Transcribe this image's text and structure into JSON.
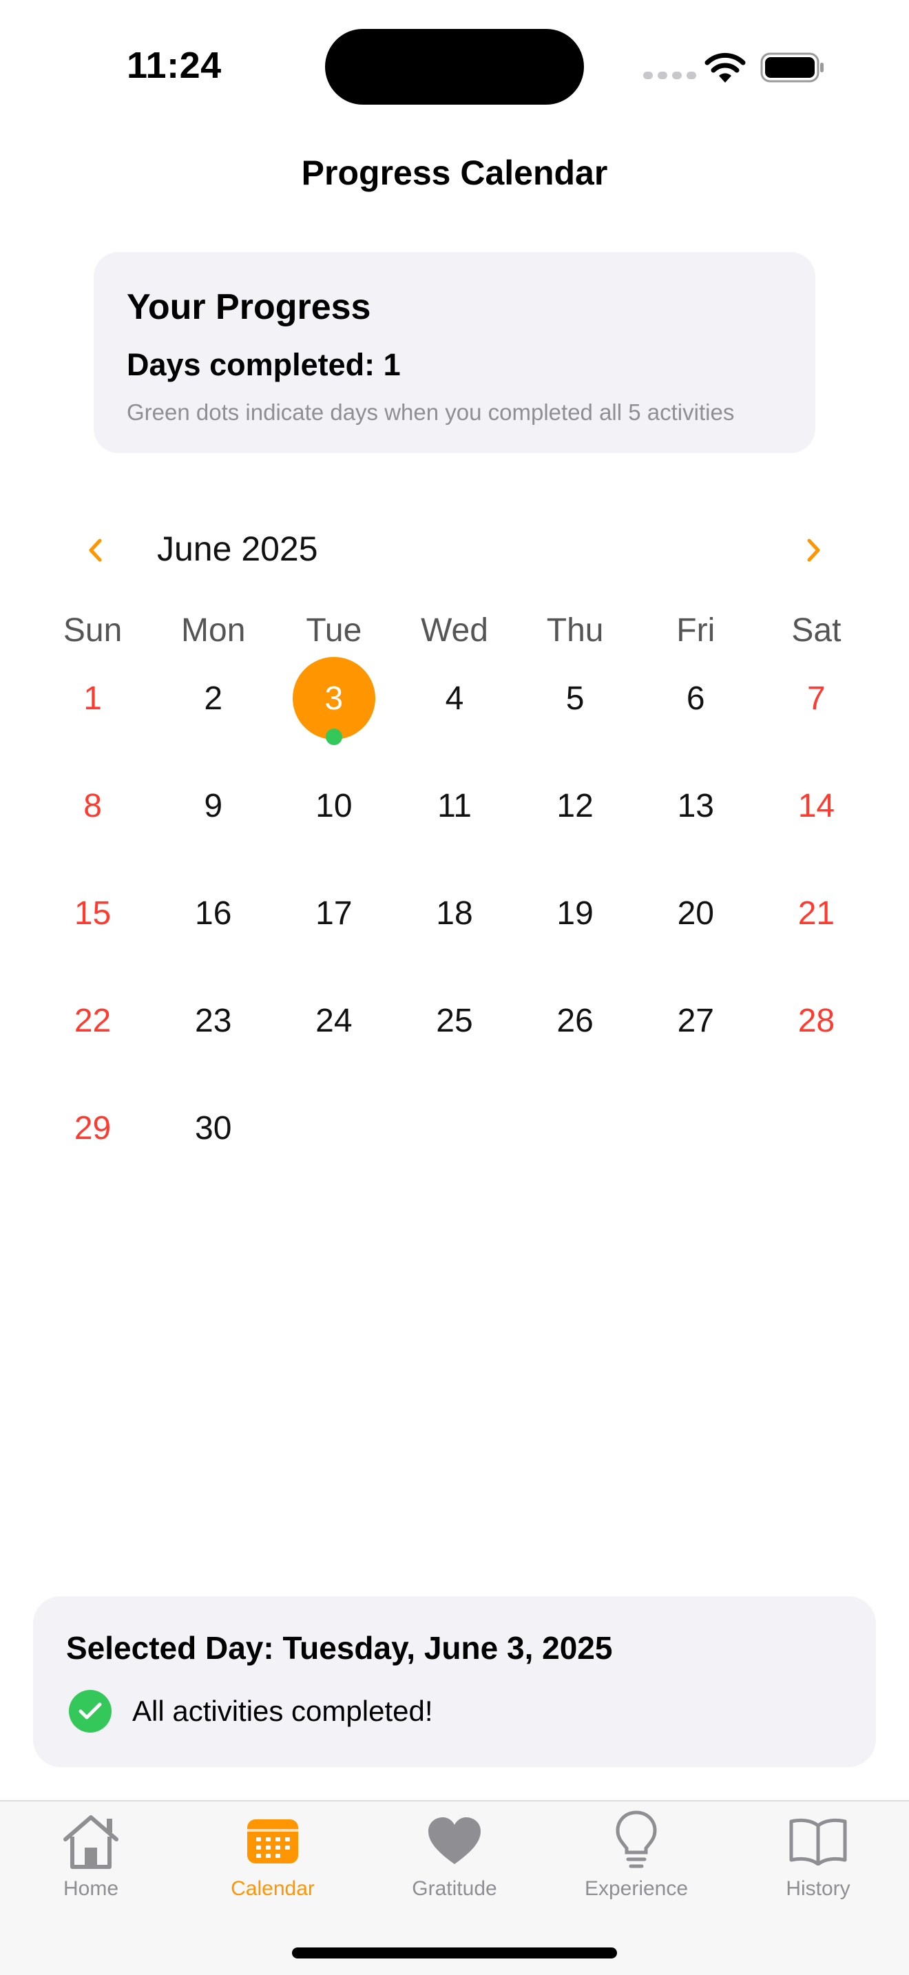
{
  "status": {
    "time": "11:24"
  },
  "nav": {
    "title": "Progress Calendar"
  },
  "progress": {
    "title": "Your Progress",
    "days_completed": "Days completed: 1",
    "hint": "Green dots indicate days when you completed all 5 activities"
  },
  "calendar": {
    "month": "June 2025",
    "weekdays": [
      "Sun",
      "Mon",
      "Tue",
      "Wed",
      "Thu",
      "Fri",
      "Sat"
    ],
    "days": [
      "1",
      "2",
      "3",
      "4",
      "5",
      "6",
      "7",
      "8",
      "9",
      "10",
      "11",
      "12",
      "13",
      "14",
      "15",
      "16",
      "17",
      "18",
      "19",
      "20",
      "21",
      "22",
      "23",
      "24",
      "25",
      "26",
      "27",
      "28",
      "29",
      "30"
    ],
    "selected_day": "3",
    "completed_days": [
      "3"
    ]
  },
  "selected": {
    "title": "Selected Day: Tuesday, June 3, 2025",
    "status": "All activities completed!"
  },
  "tabs": [
    {
      "label": "Home",
      "icon": "house-icon"
    },
    {
      "label": "Calendar",
      "icon": "calendar-icon"
    },
    {
      "label": "Gratitude",
      "icon": "heart-icon"
    },
    {
      "label": "Experience",
      "icon": "lightbulb-icon"
    },
    {
      "label": "History",
      "icon": "book-icon"
    }
  ],
  "colors": {
    "accent": "#ff9500",
    "weekend": "#ff3b30",
    "success": "#34c759",
    "inactive": "#8e8e93"
  }
}
